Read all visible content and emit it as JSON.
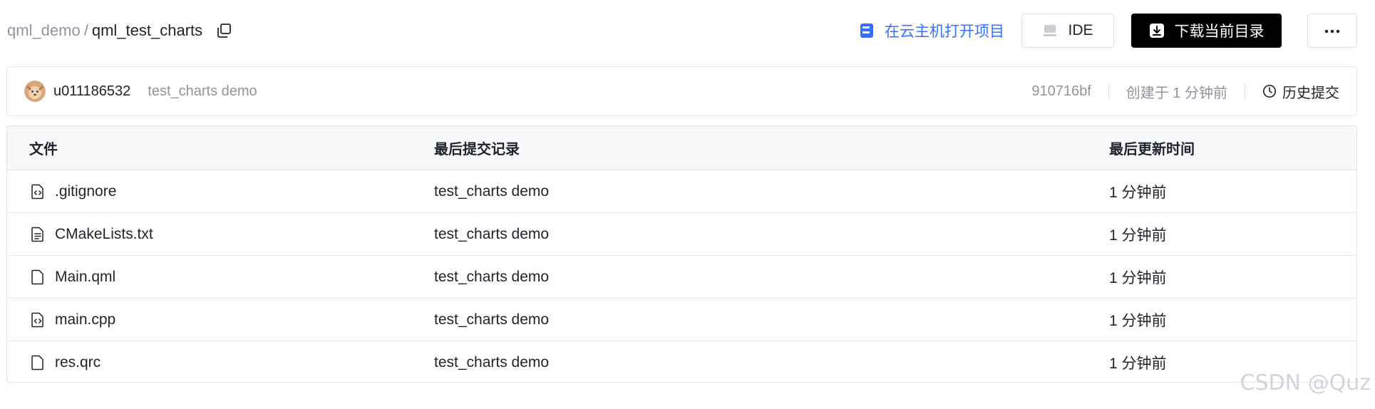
{
  "breadcrumb": {
    "parent": "qml_demo",
    "separator": "/",
    "current": "qml_test_charts"
  },
  "actions": {
    "open_cloud_label": "在云主机打开项目",
    "ide_label": "IDE",
    "download_label": "下载当前目录",
    "more_label": "···"
  },
  "commit": {
    "author": "u011186532",
    "message": "test_charts demo",
    "hash": "910716bf",
    "created": "创建于 1 分钟前",
    "history_label": "历史提交"
  },
  "table": {
    "headers": {
      "file": "文件",
      "last_commit": "最后提交记录",
      "last_updated": "最后更新时间"
    },
    "rows": [
      {
        "name": ".gitignore",
        "icon": "code-file-icon",
        "commit": "test_charts demo",
        "time": "1 分钟前"
      },
      {
        "name": "CMakeLists.txt",
        "icon": "text-file-icon",
        "commit": "test_charts demo",
        "time": "1 分钟前"
      },
      {
        "name": "Main.qml",
        "icon": "file-icon",
        "commit": "test_charts demo",
        "time": "1 分钟前"
      },
      {
        "name": "main.cpp",
        "icon": "code-file-icon",
        "commit": "test_charts demo",
        "time": "1 分钟前"
      },
      {
        "name": "res.qrc",
        "icon": "file-icon",
        "commit": "test_charts demo",
        "time": "1 分钟前"
      }
    ]
  },
  "watermark": "CSDN @Quz",
  "colors": {
    "accent": "#3370ff",
    "download_bg": "#000000",
    "muted_text": "#8f959e",
    "border": "#e5e6eb",
    "header_bg": "#f7f8fa"
  }
}
